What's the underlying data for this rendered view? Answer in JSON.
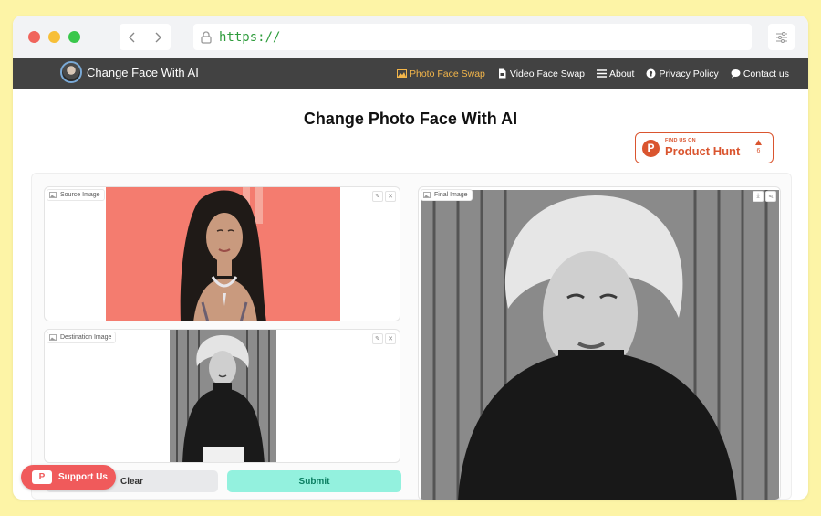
{
  "browser": {
    "url": "https://",
    "back_icon": "chevron-left-icon",
    "forward_icon": "chevron-right-icon",
    "lock_icon": "lock-icon",
    "menu_icon": "sliders-icon"
  },
  "site": {
    "brand": "Change Face With AI",
    "nav": [
      {
        "label": "Photo Face Swap",
        "icon": "image-icon",
        "active": true
      },
      {
        "label": "Video Face Swap",
        "icon": "file-icon",
        "active": false
      },
      {
        "label": "About",
        "icon": "list-icon",
        "active": false
      },
      {
        "label": "Privacy Policy",
        "icon": "shield-icon",
        "active": false
      },
      {
        "label": "Contact us",
        "icon": "chat-icon",
        "active": false
      }
    ]
  },
  "main": {
    "title": "Change Photo Face With AI"
  },
  "product_hunt": {
    "small": "FIND US ON",
    "name": "Product Hunt",
    "letter": "P",
    "votes": "6"
  },
  "panels": {
    "source_label": "Source Image",
    "destination_label": "Destination Image",
    "final_label": "Final Image"
  },
  "buttons": {
    "clear": "Clear",
    "submit": "Submit"
  },
  "support": {
    "label": "Support Us",
    "cup": "P"
  },
  "colors": {
    "page_bg": "#fdf4a6",
    "navbar": "#424242",
    "active_nav": "#f4b64a",
    "product_hunt": "#da552f",
    "submit_bg": "#93f1de",
    "support_bg": "#f05a5b"
  }
}
